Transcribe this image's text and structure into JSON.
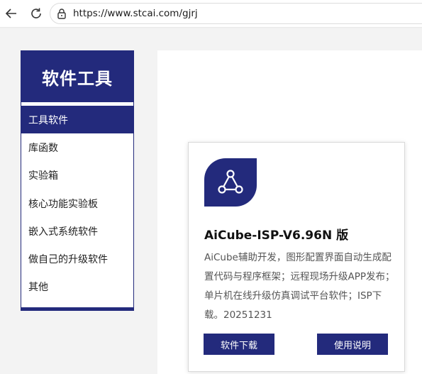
{
  "browser": {
    "url": "https://www.stcai.com/gjrj"
  },
  "sidebar": {
    "title": "软件工具",
    "items": [
      {
        "label": "工具软件",
        "active": true
      },
      {
        "label": "库函数",
        "active": false
      },
      {
        "label": "实验箱",
        "active": false
      },
      {
        "label": "核心功能实验板",
        "active": false
      },
      {
        "label": "嵌入式系统软件",
        "active": false
      },
      {
        "label": "做自己的升级软件",
        "active": false
      },
      {
        "label": "其他",
        "active": false
      }
    ]
  },
  "card": {
    "icon": "share-icon",
    "title": "AiCube-ISP-V6.96N 版",
    "description": "AiCube辅助开发，图形配置界面自动生成配置代码与程序框架；远程现场升级APP发布；单片机在线升级仿真调试平台软件；ISP下载。20251231",
    "download_label": "软件下载",
    "manual_label": "使用说明"
  },
  "colors": {
    "brand": "#232a7c",
    "page_bg": "#f3f3f3"
  }
}
